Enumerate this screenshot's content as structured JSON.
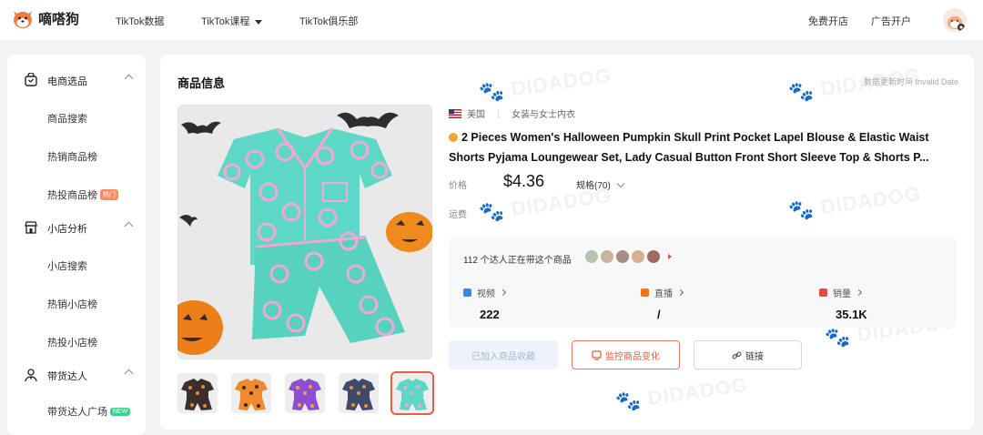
{
  "app": {
    "logo_text": "嘀嗒狗",
    "nav": [
      {
        "label": "TikTok数据"
      },
      {
        "label": "TikTok课程"
      },
      {
        "label": "TikTok俱乐部"
      }
    ],
    "top_right": [
      {
        "label": "免费开店"
      },
      {
        "label": "广告开户"
      }
    ]
  },
  "sidebar": {
    "groups": [
      {
        "label": "电商选品",
        "items": [
          {
            "label": "商品搜索"
          },
          {
            "label": "热销商品榜"
          },
          {
            "label": "热投商品榜",
            "tag": "热门"
          }
        ]
      },
      {
        "label": "小店分析",
        "items": [
          {
            "label": "小店搜索"
          },
          {
            "label": "热销小店榜"
          },
          {
            "label": "热投小店榜"
          }
        ]
      },
      {
        "label": "带货达人",
        "items": [
          {
            "label": "带货达人广场",
            "tag": "NEW"
          }
        ]
      }
    ]
  },
  "product": {
    "section_title": "商品信息",
    "update_time": "数据更新时间 Invalid Date",
    "country": "美国",
    "category": "女装与女士内衣",
    "title": "2 Pieces Women's Halloween Pumpkin Skull Print Pocket Lapel Blouse & Elastic Waist Shorts Pyjama Loungewear Set, Lady Casual Button Front Short Sleeve Top & Shorts P...",
    "price_label": "价格",
    "price": "$4.36",
    "spec": "规格(70)",
    "shipping_label": "运费",
    "influencer_text": "112 个达人正在带这个商品",
    "stats": [
      {
        "label": "视频",
        "value": "222",
        "color": "#3b82f6"
      },
      {
        "label": "直播",
        "value": "/",
        "color": "#f97316"
      },
      {
        "label": "销量",
        "value": "35.1K",
        "color": "#ef4444"
      }
    ],
    "buttons": {
      "favorite": "已加入商品收藏",
      "monitor": "监控商品变化",
      "link": "链接"
    },
    "thumbnails": [
      {
        "name": "black"
      },
      {
        "name": "orange"
      },
      {
        "name": "purple"
      },
      {
        "name": "navy"
      },
      {
        "name": "mint"
      }
    ]
  },
  "colors": {
    "accent": "#e85c4a",
    "mint": "#5ed8c6",
    "pink_print": "#f4a6d7"
  }
}
